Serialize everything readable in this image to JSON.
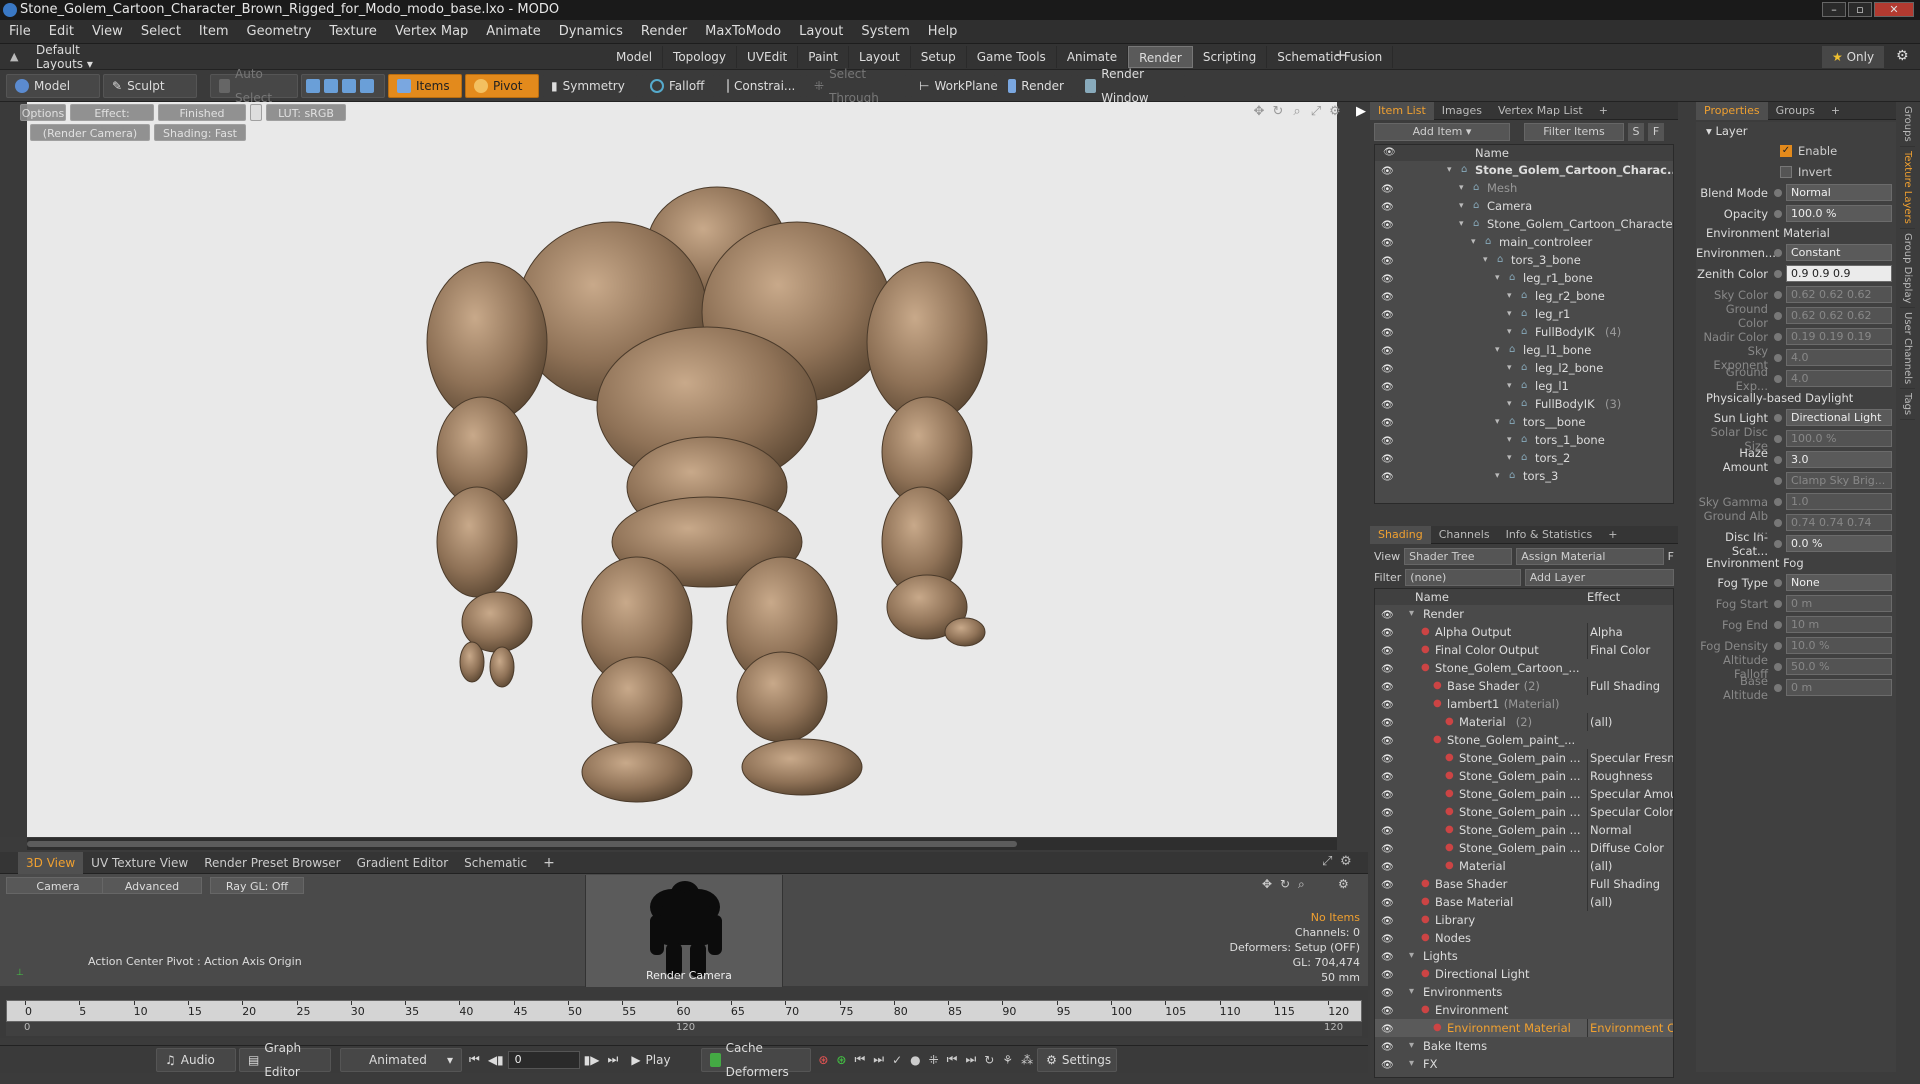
{
  "window": {
    "title": "Stone_Golem_Cartoon_Character_Brown_Rigged_for_Modo_modo_base.lxo - MODO"
  },
  "menu": [
    "File",
    "Edit",
    "View",
    "Select",
    "Item",
    "Geometry",
    "Texture",
    "Vertex Map",
    "Animate",
    "Dynamics",
    "Render",
    "MaxToModo",
    "Layout",
    "System",
    "Help"
  ],
  "layouts": {
    "dropdown": "Default Layouts",
    "tabs": [
      "Model",
      "Topology",
      "UVEdit",
      "Paint",
      "Layout",
      "Setup",
      "Game Tools",
      "Animate",
      "Render",
      "Scripting",
      "Schematic Fusion"
    ],
    "active": "Render",
    "only": "Only"
  },
  "toolbar": {
    "model": "Model",
    "sculpt": "Sculpt",
    "auto_select": "Auto Select",
    "items": "Items",
    "pivot": "Pivot",
    "symmetry": "Symmetry",
    "falloff": "Falloff",
    "constrain": "Constrai...",
    "select_through": "Select Through",
    "workplane": "WorkPlane",
    "render": "Render",
    "render_window": "Render Window"
  },
  "viewport": {
    "options": "Options",
    "effect": "Effect: (Shadi...",
    "status": "Finished",
    "lut": "LUT: sRGB",
    "camera": "(Render Camera)",
    "shading": "Shading: Fast"
  },
  "bottom_tabs": [
    "3D View",
    "UV Texture View",
    "Render Preset Browser",
    "Gradient Editor",
    "Schematic"
  ],
  "bottom": {
    "camera": "Camera",
    "advanced": "Advanced",
    "raygl": "Ray GL: Off",
    "action_center": "Action Center Pivot : Action Axis Origin",
    "thumb_label": "Render Camera",
    "stats": [
      "No Items",
      "Channels: 0",
      "Deformers: Setup (OFF)",
      "GL: 704,474",
      "50 mm"
    ]
  },
  "timeline": {
    "ticks": [
      "0",
      "5",
      "10",
      "15",
      "20",
      "25",
      "30",
      "35",
      "40",
      "45",
      "50",
      "55",
      "60",
      "65",
      "70",
      "75",
      "80",
      "85",
      "90",
      "95",
      "100",
      "105",
      "110",
      "115",
      "120"
    ],
    "sub_left": "0",
    "sub_mid": "120",
    "sub_right": "120"
  },
  "transport": {
    "audio": "Audio",
    "graph": "Graph Editor",
    "animated": "Animated",
    "frame": "0",
    "play": "Play",
    "cache": "Cache Deformers",
    "settings": "Settings"
  },
  "itemlist": {
    "tabs": [
      "Item List",
      "Images",
      "Vertex Map List"
    ],
    "add_item": "Add Item",
    "filter": "Filter Items",
    "s": "S",
    "f": "F",
    "col": "Name",
    "rows": [
      {
        "d": 1,
        "t": "Stone_Golem_Cartoon_Charac...",
        "b": true
      },
      {
        "d": 2,
        "t": "Mesh",
        "dim": true
      },
      {
        "d": 2,
        "t": "Camera"
      },
      {
        "d": 2,
        "t": "Stone_Golem_Cartoon_Character..."
      },
      {
        "d": 3,
        "t": "main_controleer"
      },
      {
        "d": 4,
        "t": "tors_3_bone"
      },
      {
        "d": 5,
        "t": "leg_r1_bone"
      },
      {
        "d": 6,
        "t": "leg_r2_bone"
      },
      {
        "d": 6,
        "t": "leg_r1"
      },
      {
        "d": 6,
        "t": "FullBodyIK",
        "x": "(4)"
      },
      {
        "d": 5,
        "t": "leg_l1_bone"
      },
      {
        "d": 6,
        "t": "leg_l2_bone"
      },
      {
        "d": 6,
        "t": "leg_l1"
      },
      {
        "d": 6,
        "t": "FullBodyIK",
        "x": "(3)"
      },
      {
        "d": 5,
        "t": "tors__bone"
      },
      {
        "d": 6,
        "t": "tors_1_bone"
      },
      {
        "d": 6,
        "t": "tors_2"
      },
      {
        "d": 5,
        "t": "tors_3"
      }
    ]
  },
  "shading": {
    "tabs": [
      "Shading",
      "Channels",
      "Info & Statistics"
    ],
    "view_label": "View",
    "view": "Shader Tree",
    "assign": "Assign Material",
    "f": "F",
    "filter_label": "Filter",
    "filter": "(none)",
    "add_layer": "Add Layer",
    "col_name": "Name",
    "col_effect": "Effect",
    "rows": [
      {
        "d": 0,
        "t": "Render",
        "e": ""
      },
      {
        "d": 1,
        "t": "Alpha Output",
        "e": "Alpha"
      },
      {
        "d": 1,
        "t": "Final Color Output",
        "e": "Final Color"
      },
      {
        "d": 1,
        "t": "Stone_Golem_Cartoon_...",
        "e": ""
      },
      {
        "d": 2,
        "t": "Base Shader",
        "x": "(2)",
        "e": "Full Shading"
      },
      {
        "d": 2,
        "t": "lambert1",
        "x": "(Material)",
        "e": ""
      },
      {
        "d": 3,
        "t": "Material",
        "x": "(2)",
        "e": "(all)"
      },
      {
        "d": 2,
        "t": "Stone_Golem_paint_...",
        "e": ""
      },
      {
        "d": 3,
        "t": "Stone_Golem_pain ...",
        "e": "Specular Fresnel"
      },
      {
        "d": 3,
        "t": "Stone_Golem_pain ...",
        "e": "Roughness"
      },
      {
        "d": 3,
        "t": "Stone_Golem_pain ...",
        "e": "Specular Amount"
      },
      {
        "d": 3,
        "t": "Stone_Golem_pain ...",
        "e": "Specular Color"
      },
      {
        "d": 3,
        "t": "Stone_Golem_pain ...",
        "e": "Normal"
      },
      {
        "d": 3,
        "t": "Stone_Golem_pain ...",
        "e": "Diffuse Color"
      },
      {
        "d": 3,
        "t": "Material",
        "e": "(all)"
      },
      {
        "d": 1,
        "t": "Base Shader",
        "e": "Full Shading"
      },
      {
        "d": 1,
        "t": "Base Material",
        "e": "(all)"
      },
      {
        "d": 1,
        "t": "Library",
        "e": ""
      },
      {
        "d": 1,
        "t": "Nodes",
        "e": ""
      },
      {
        "d": 0,
        "t": "Lights",
        "e": ""
      },
      {
        "d": 1,
        "t": "Directional Light",
        "e": ""
      },
      {
        "d": 0,
        "t": "Environments",
        "e": ""
      },
      {
        "d": 1,
        "t": "Environment",
        "e": ""
      },
      {
        "d": 2,
        "t": "Environment Material",
        "e": "Environment Co...",
        "sel": true
      },
      {
        "d": 0,
        "t": "Bake Items",
        "e": ""
      },
      {
        "d": 0,
        "t": "FX",
        "e": ""
      }
    ]
  },
  "properties": {
    "tabs": [
      "Properties",
      "Groups"
    ],
    "layer": "Layer",
    "enable": "Enable",
    "invert": "Invert",
    "rows": [
      {
        "l": "Blend Mode",
        "v": "Normal",
        "dd": true
      },
      {
        "l": "Opacity",
        "v": "100.0 %"
      },
      {
        "sec": "Environment Material"
      },
      {
        "l": "Environmen...",
        "v": "Constant",
        "dd": true
      },
      {
        "l": "Zenith Color",
        "v": "0.9  0.9  0.9",
        "light": true
      },
      {
        "l": "Sky Color",
        "v": "0.62  0.62  0.62",
        "dim": true
      },
      {
        "l": "Ground Color",
        "v": "0.62  0.62  0.62",
        "dim": true
      },
      {
        "l": "Nadir Color",
        "v": "0.19  0.19  0.19",
        "dim": true
      },
      {
        "l": "Sky Exponent",
        "v": "4.0",
        "dim": true
      },
      {
        "l": "Ground Exp...",
        "v": "4.0",
        "dim": true
      },
      {
        "sec": "Physically-based Daylight"
      },
      {
        "l": "Sun Light",
        "v": "Directional Light",
        "dd": true
      },
      {
        "l": "Solar Disc Size",
        "v": "100.0 %",
        "dim": true
      },
      {
        "l": "Haze Amount",
        "v": "3.0"
      },
      {
        "l": "",
        "v": "Clamp Sky Brig...",
        "dim": true
      },
      {
        "l": "Sky Gamma",
        "v": "1.0",
        "dim": true
      },
      {
        "l": "Ground Alb ...",
        "v": "0.74  0.74  0.74",
        "dim": true
      },
      {
        "l": "Disc In-Scat...",
        "v": "0.0 %"
      },
      {
        "sec": "Environment Fog"
      },
      {
        "l": "Fog Type",
        "v": "None",
        "dd": true
      },
      {
        "l": "Fog Start",
        "v": "0 m",
        "dim": true
      },
      {
        "l": "Fog End",
        "v": "10 m",
        "dim": true
      },
      {
        "l": "Fog Density",
        "v": "10.0 %",
        "dim": true
      },
      {
        "l": "Altitude Falloff",
        "v": "50.0 %",
        "dim": true
      },
      {
        "l": "Base Altitude",
        "v": "0 m",
        "dim": true
      }
    ]
  },
  "side_tabs": [
    "Groups",
    "Texture Layers",
    "Group Display",
    "User Channels",
    "Tags"
  ]
}
